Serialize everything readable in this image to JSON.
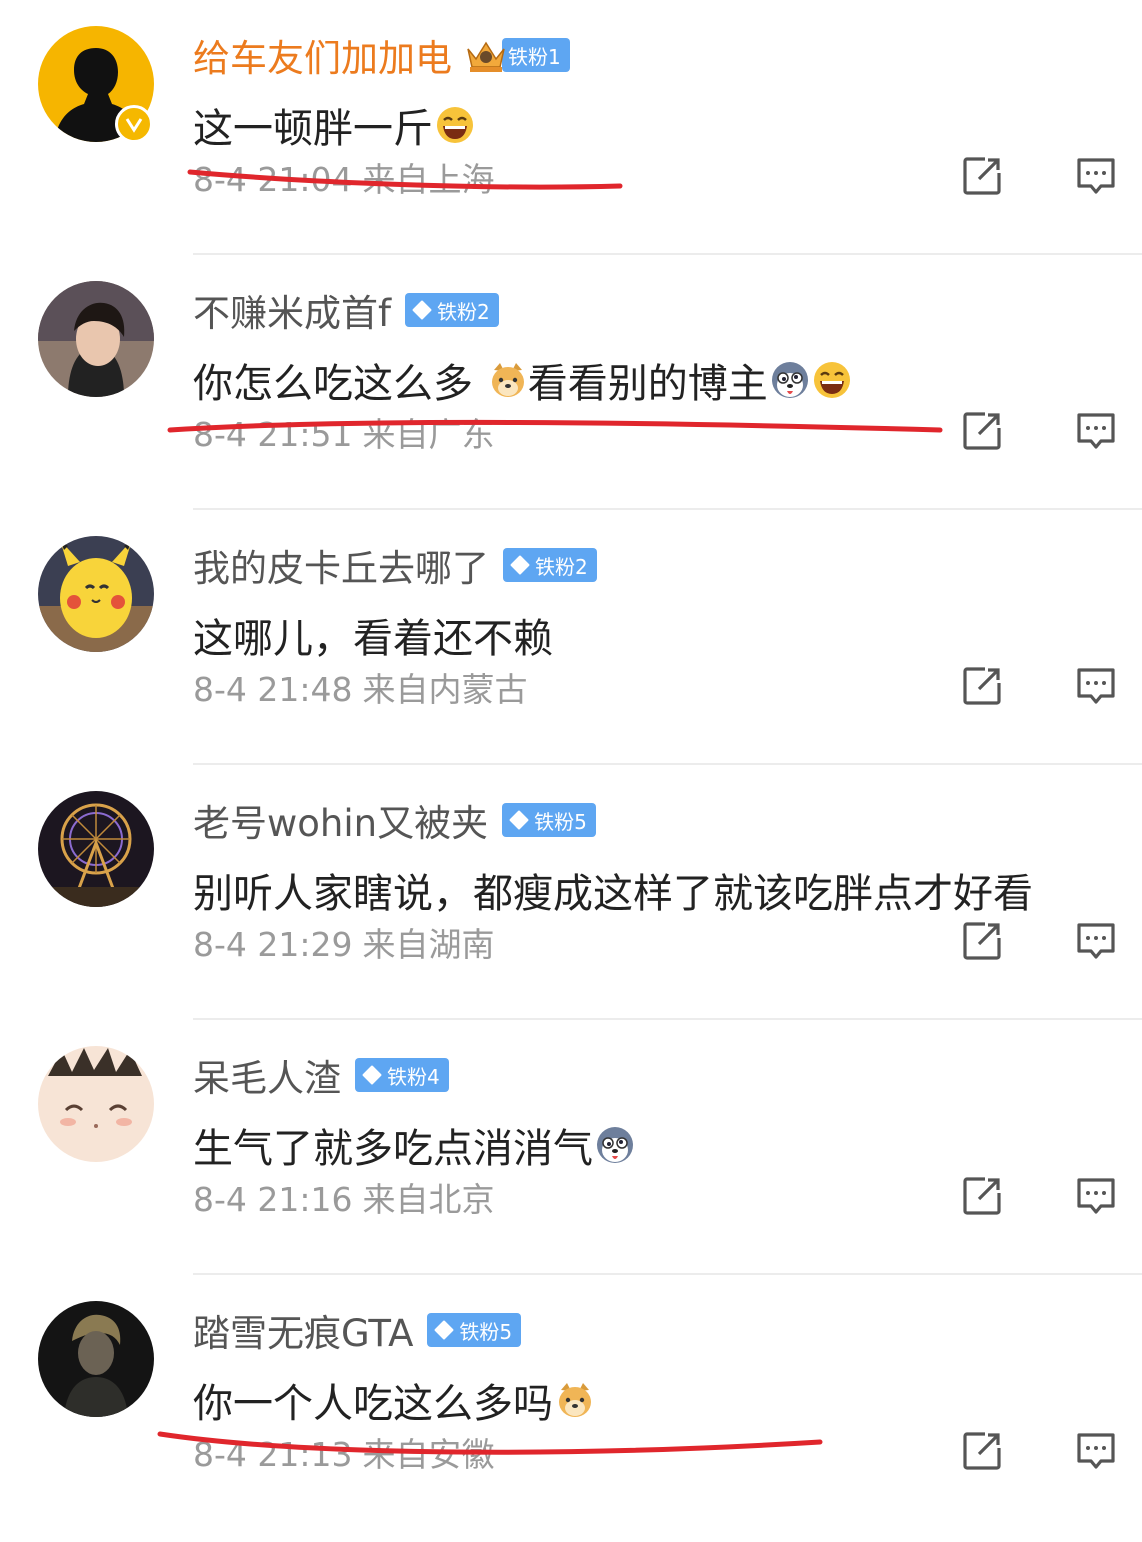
{
  "colors": {
    "vip_name": "#ec7b1e",
    "fan_badge": "#5ea6f2",
    "meta_text": "#9a9a9a",
    "underline": "#e0262c"
  },
  "comments": [
    {
      "username": "给车友们加加电",
      "badge": "铁粉1",
      "text": "这一顿胖一斤",
      "emojis": [
        "laugh-emoji"
      ],
      "time": "8-4 21:04",
      "location": "来自上海",
      "verified": true,
      "vip": true
    },
    {
      "username": "不赚米成首f",
      "badge": "铁粉2",
      "text_a": "你怎么吃这么多 ",
      "text_b": "看看别的博主",
      "emojis": [
        "doge-emoji",
        "husky-emoji",
        "laugh-emoji"
      ],
      "time": "8-4 21:51",
      "location": "来自广东"
    },
    {
      "username": "我的皮卡丘去哪了",
      "badge": "铁粉2",
      "text": "这哪儿，看着还不赖",
      "time": "8-4 21:48",
      "location": "来自内蒙古"
    },
    {
      "username": "老号wohin又被夹",
      "badge": "铁粉5",
      "text": "别听人家瞎说，都瘦成这样了就该吃胖点才好看",
      "time": "8-4 21:29",
      "location": "来自湖南"
    },
    {
      "username": "呆毛人渣",
      "badge": "铁粉4",
      "text": "生气了就多吃点消消气",
      "emojis": [
        "husky-emoji"
      ],
      "time": "8-4 21:16",
      "location": "来自北京"
    },
    {
      "username": "踏雪无痕GTA",
      "badge": "铁粉5",
      "text": "你一个人吃这么多吗",
      "emojis": [
        "doge-emoji"
      ],
      "time": "8-4 21:13",
      "location": "来自安徽"
    }
  ]
}
